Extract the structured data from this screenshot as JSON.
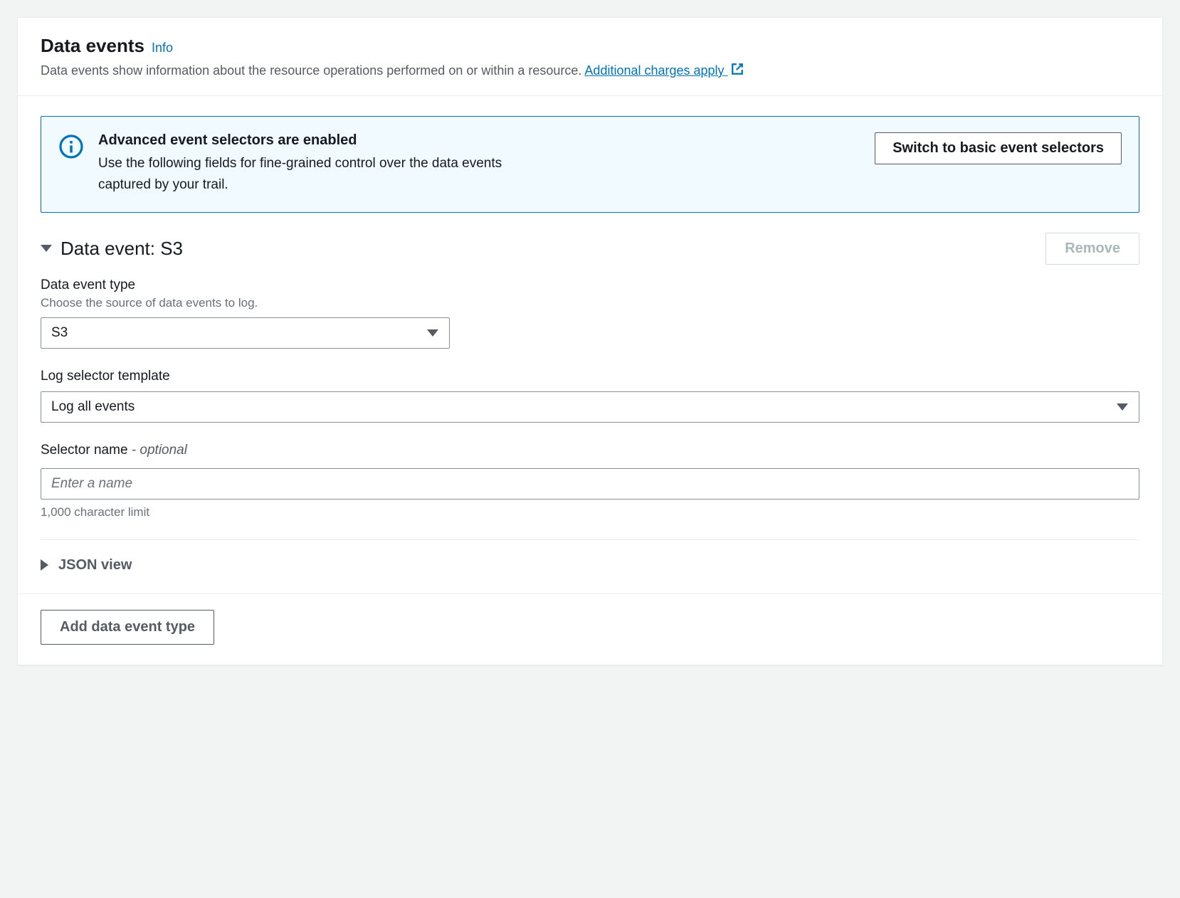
{
  "header": {
    "title": "Data events",
    "info_label": "Info",
    "description": "Data events show information about the resource operations performed on or within a resource. ",
    "charges_link": "Additional charges apply"
  },
  "alert": {
    "title": "Advanced event selectors are enabled",
    "text": "Use the following fields for fine-grained control over the data events captured by your trail.",
    "switch_button": "Switch to basic event selectors"
  },
  "data_event": {
    "section_title": "Data event: S3",
    "remove_button": "Remove",
    "type": {
      "label": "Data event type",
      "hint": "Choose the source of data events to log.",
      "value": "S3"
    },
    "template": {
      "label": "Log selector template",
      "value": "Log all events"
    },
    "selector_name": {
      "label": "Selector name",
      "optional_suffix": " - optional",
      "placeholder": "Enter a name",
      "value": "",
      "constraint": "1,000 character limit"
    },
    "json_view_label": "JSON view"
  },
  "footer": {
    "add_button": "Add data event type"
  }
}
